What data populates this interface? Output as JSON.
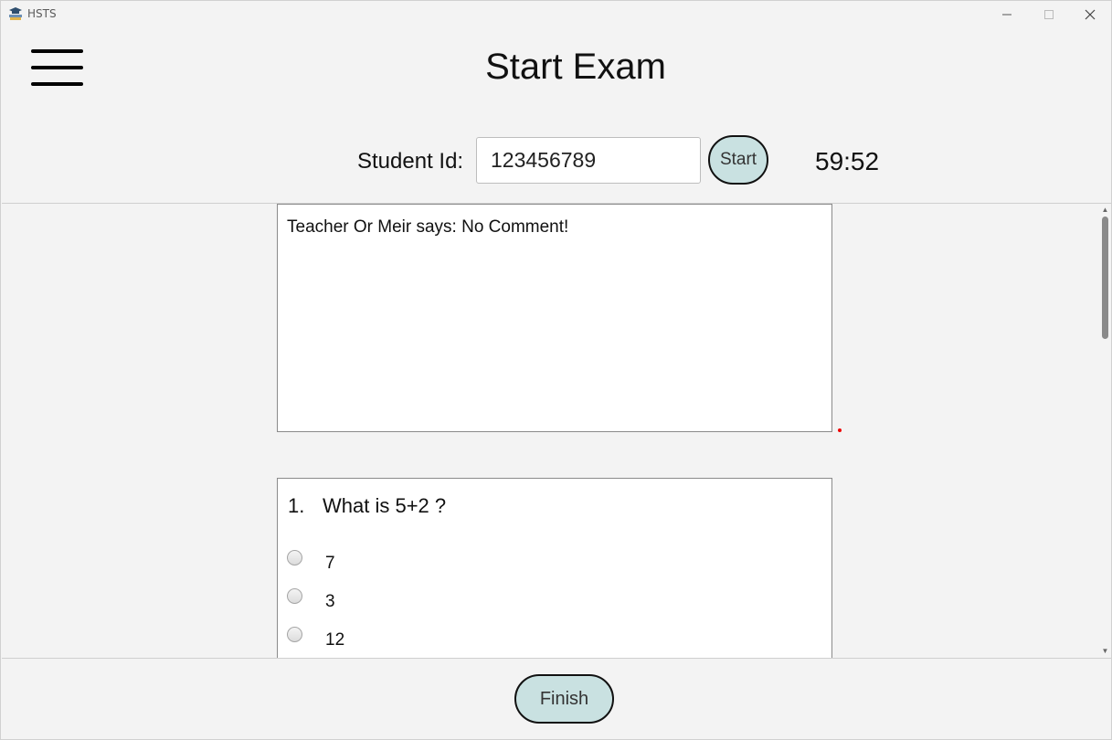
{
  "window": {
    "title": "HSTS"
  },
  "header": {
    "title": "Start Exam"
  },
  "student": {
    "label": "Student Id:",
    "value": "123456789"
  },
  "start_button": {
    "label": "Start"
  },
  "timer": {
    "value": "59:52"
  },
  "comment": {
    "text": "Teacher Or Meir says: No Comment!"
  },
  "question": {
    "number": "1.",
    "text": "What is 5+2 ?",
    "answers": [
      {
        "label": "7"
      },
      {
        "label": "3"
      },
      {
        "label": "12"
      }
    ]
  },
  "finish_button": {
    "label": "Finish"
  },
  "colors": {
    "accent_button": "#c9e1e1",
    "background": "#f3f3f3"
  }
}
